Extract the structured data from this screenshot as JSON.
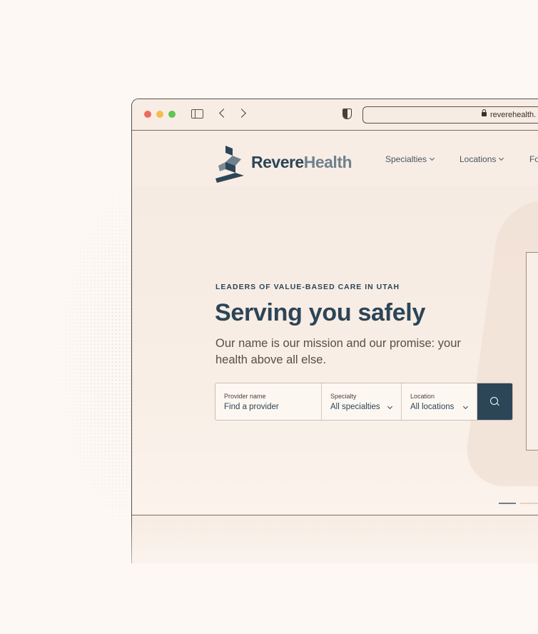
{
  "browser": {
    "url": "reverehealth."
  },
  "site": {
    "logo": {
      "word1": "Revere",
      "word2": "Health"
    },
    "nav": [
      {
        "label": "Specialties"
      },
      {
        "label": "Locations"
      },
      {
        "label": "Fo"
      }
    ]
  },
  "hero": {
    "eyebrow": "LEADERS OF VALUE-BASED CARE IN UTAH",
    "headline": "Serving you safely",
    "subhead": "Our name is our mission and our promise: your health above all else.",
    "search": {
      "provider": {
        "label": "Provider name",
        "placeholder": "Find a provider"
      },
      "specialty": {
        "label": "Specialty",
        "value": "All specialties"
      },
      "location": {
        "label": "Location",
        "value": "All locations"
      }
    },
    "carousel": {
      "active_index": 1,
      "count": 2
    }
  },
  "colors": {
    "brand_navy": "#2c4557",
    "brand_slate": "#6f818d",
    "background": "#fdf8f4"
  }
}
